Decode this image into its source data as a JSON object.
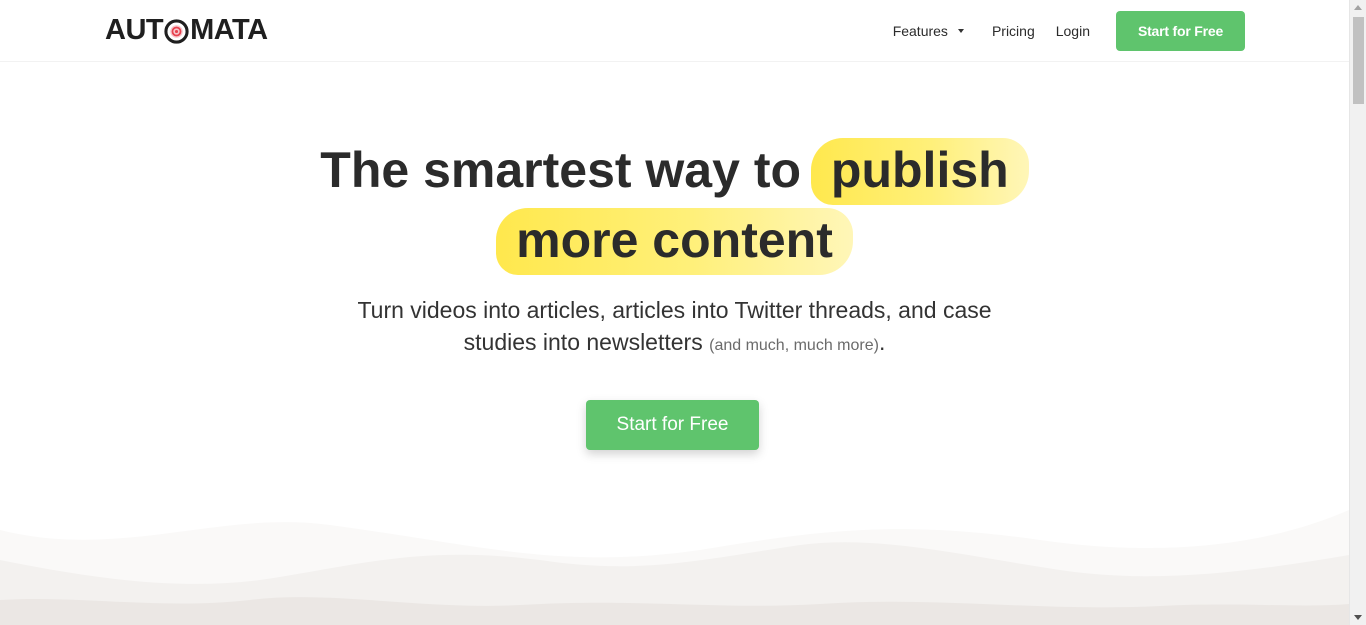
{
  "header": {
    "logo": {
      "before": "AUT",
      "after": "MATA"
    },
    "nav": {
      "features": "Features",
      "pricing": "Pricing",
      "login": "Login",
      "cta": "Start for Free"
    }
  },
  "hero": {
    "title_prefix": "The smartest way to",
    "title_highlight_1": "publish",
    "title_highlight_2": "more content",
    "subtitle_line1": "Turn videos into articles, articles into Twitter threads, and case",
    "subtitle_line2": "studies into newsletters",
    "subtitle_small": "(and much, much more)",
    "subtitle_end": ".",
    "cta": "Start for Free"
  },
  "colors": {
    "accent_green": "#5fc46d",
    "highlight_yellow": "#ffe84d",
    "text_dark": "#2b2b2b",
    "logo_red": "#e8424f"
  },
  "icons": {
    "logo_mark": "target-o-icon",
    "features_caret": "caret-down-icon"
  }
}
